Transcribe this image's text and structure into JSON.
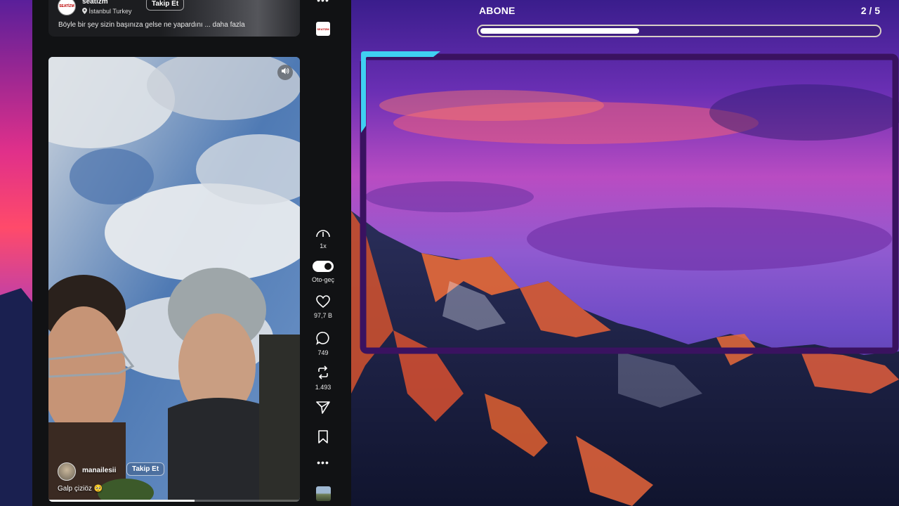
{
  "previous_reel": {
    "username": "seatizm",
    "location": "İstanbul Turkey",
    "follow_label": "Takip Et",
    "caption": "Böyle bir şey sizin başınıza gelse ne yapardını ... daha fazla",
    "avatar_text": "SEATİZM"
  },
  "current_reel": {
    "username": "manailesii",
    "follow_label": "Takip Et",
    "caption": "Galp çiziöz 🥺",
    "progress_fraction": 0.58
  },
  "side_rail": {
    "more_top": "•••",
    "logo_text": "SEATİZM",
    "speed_label": "1x",
    "autoplay_label": "Oto-geç",
    "autoplay_on": true,
    "likes": "97,7 B",
    "comments": "749",
    "reposts": "1.493",
    "more_bottom": "•••"
  },
  "overlay": {
    "title": "ABONE",
    "counter": "2 / 5",
    "progress_fraction": 0.4,
    "frame_accent": "#3fd0f2",
    "frame_color": "#3a1260"
  },
  "icons": {
    "location": "location-pin-icon",
    "mute": "speaker-icon",
    "speed": "gauge-icon",
    "like": "heart-icon",
    "comment": "comment-icon",
    "repost": "repost-icon",
    "share": "send-icon",
    "save": "bookmark-icon"
  }
}
